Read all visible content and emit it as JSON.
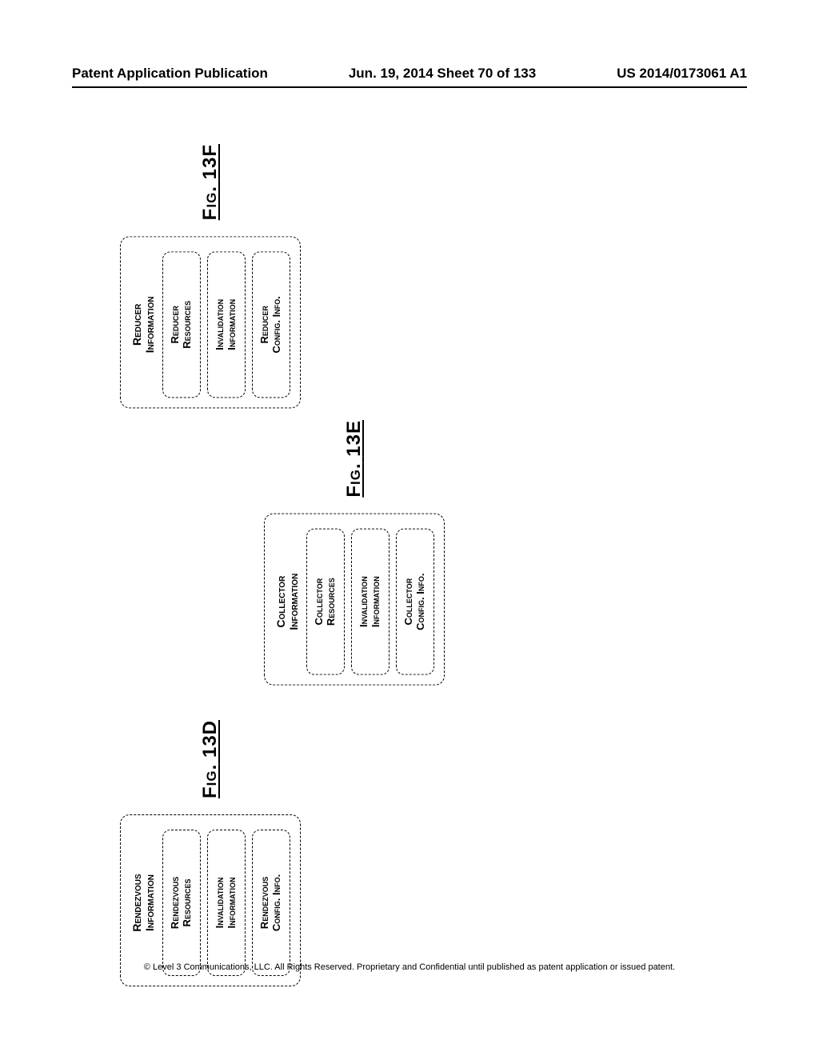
{
  "header": {
    "left": "Patent Application Publication",
    "center": "Jun. 19, 2014  Sheet 70 of 133",
    "right": "US 2014/0173061 A1"
  },
  "figures": {
    "f13f": {
      "caption_prefix": "Fig.",
      "caption_num": "13F",
      "outer_title_l1": "Reducer",
      "outer_title_l2": "Information",
      "boxes": {
        "b1_l1": "Reducer",
        "b1_l2": "Resources",
        "b2_l1": "Invalidation",
        "b2_l2": "Information",
        "b3_l1": "Reducer",
        "b3_l2": "Config. Info."
      }
    },
    "f13e": {
      "caption_prefix": "Fig.",
      "caption_num": "13E",
      "outer_title_l1": "Collector",
      "outer_title_l2": "Information",
      "boxes": {
        "b1_l1": "Collector",
        "b1_l2": "Resources",
        "b2_l1": "Invalidation",
        "b2_l2": "Information",
        "b3_l1": "Collector",
        "b3_l2": "Config. Info."
      }
    },
    "f13d": {
      "caption_prefix": "Fig.",
      "caption_num": "13D",
      "outer_title_l1": "Rendezvous",
      "outer_title_l2": "Information",
      "boxes": {
        "b1_l1": "Rendezvous",
        "b1_l2": "Resources",
        "b2_l1": "Invalidation",
        "b2_l2": "Information",
        "b3_l1": "Rendezvous",
        "b3_l2": "Config. Info."
      }
    }
  },
  "footer": "© Level 3 Communications, LLC.  All Rights Reserved.  Proprietary and Confidential until published as patent application or issued patent."
}
